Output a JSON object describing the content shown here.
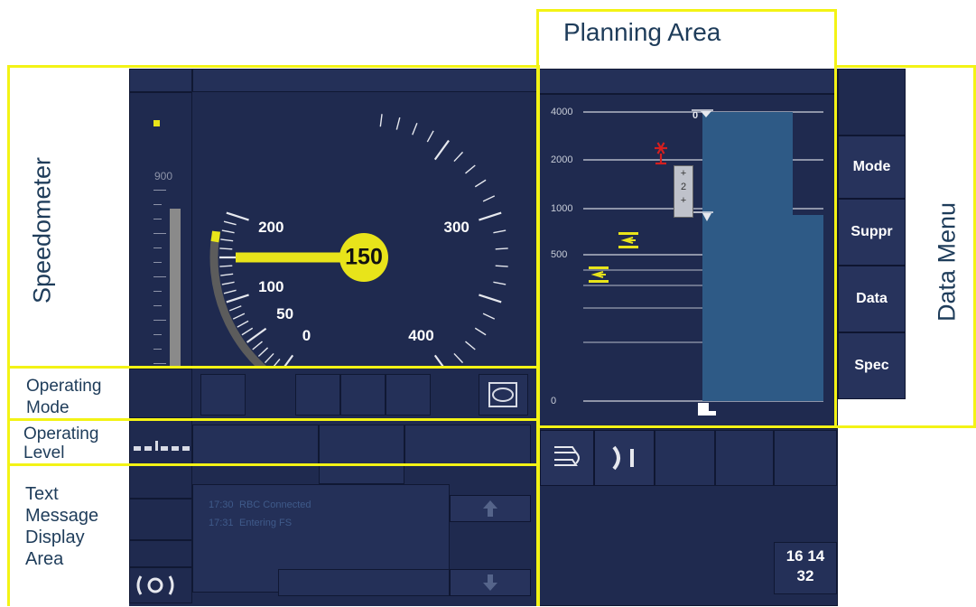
{
  "labels": {
    "speedometer": "Speedometer",
    "planning_area": "Planning Area",
    "data_menu": "Data Menu",
    "operating_mode": "Operating Mode",
    "operating_level": "Operating Level",
    "text_message": "Text Message Display Area"
  },
  "speedometer": {
    "current_speed": "150",
    "max_scale": 400,
    "dial_labels": [
      "0",
      "50",
      "100",
      "150",
      "200",
      "300",
      "400"
    ],
    "needle_speed": 150,
    "bar_label": "900"
  },
  "planning": {
    "distance_labels": [
      "4000",
      "2000",
      "1000",
      "500",
      "0"
    ],
    "gradient_label": "2",
    "marker_label": "0"
  },
  "menu": {
    "items": [
      "Mode",
      "Suppr",
      "Data",
      "Spec"
    ]
  },
  "messages": [
    {
      "time": "17:30",
      "text": "RBC Connected"
    },
    {
      "time": "17:31",
      "text": "Entering FS"
    }
  ],
  "clock": {
    "time": "16 14",
    "seconds": "32"
  },
  "colors": {
    "background": "#1f2a4f",
    "yellow": "#e8e41a",
    "gray": "#5c5c5c",
    "planning_blue": "#2e5a86",
    "frame": "#f3f315"
  }
}
